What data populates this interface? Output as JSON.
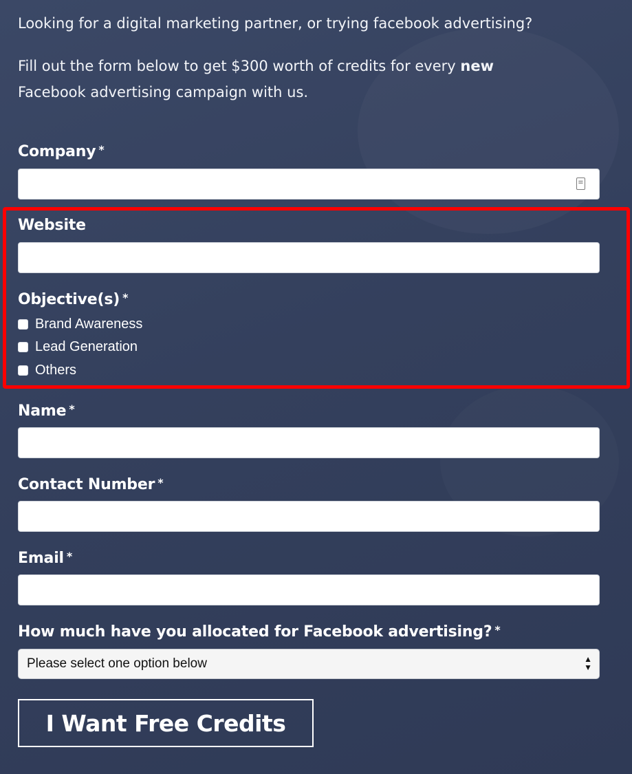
{
  "intro": {
    "line1": "Looking for a digital marketing partner, or trying facebook advertising?",
    "line2_part1": "Fill out the form below to get $300 worth of credits for every ",
    "line2_bold": "new",
    "line3": "Facebook advertising campaign with us."
  },
  "form": {
    "company": {
      "label": "Company",
      "required_mark": "*",
      "value": ""
    },
    "website": {
      "label": "Website",
      "value": ""
    },
    "objectives": {
      "label": "Objective(s)",
      "required_mark": "*",
      "options": [
        {
          "label": "Brand Awareness",
          "checked": false
        },
        {
          "label": "Lead Generation",
          "checked": false
        },
        {
          "label": "Others",
          "checked": false
        }
      ]
    },
    "name": {
      "label": "Name",
      "required_mark": "*",
      "value": ""
    },
    "contact_number": {
      "label": "Contact Number",
      "required_mark": "*",
      "value": ""
    },
    "email": {
      "label": "Email",
      "required_mark": "*",
      "value": ""
    },
    "budget": {
      "label": "How much have you allocated for Facebook advertising?",
      "required_mark": "*",
      "selected": "Please select one option below"
    },
    "submit_label": "I Want Free Credits"
  },
  "colors": {
    "background": "#34405d",
    "highlight": "#ff0000"
  }
}
